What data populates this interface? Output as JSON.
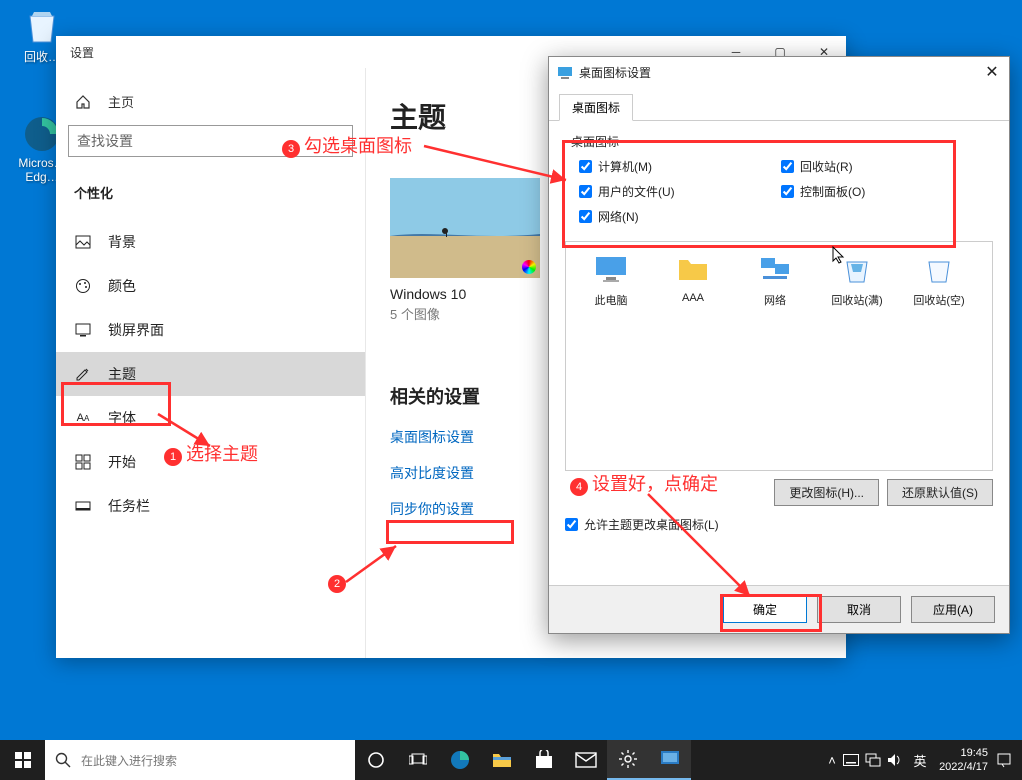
{
  "desktop": {
    "recycle_label": "回收…",
    "edge_label": "Micros… Edg…"
  },
  "settings": {
    "window_title": "设置",
    "home": "主页",
    "search_placeholder": "查找设置",
    "section": "个性化",
    "items": [
      {
        "label": "背景"
      },
      {
        "label": "颜色"
      },
      {
        "label": "锁屏界面"
      },
      {
        "label": "主题"
      },
      {
        "label": "字体"
      },
      {
        "label": "开始"
      },
      {
        "label": "任务栏"
      }
    ],
    "content": {
      "title": "主题",
      "theme_name": "Windows 10",
      "theme_sub": "5 个图像",
      "related_title": "相关的设置",
      "links": [
        "桌面图标设置",
        "高对比度设置",
        "同步你的设置"
      ]
    }
  },
  "dialog": {
    "title": "桌面图标设置",
    "tab": "桌面图标",
    "group_label": "桌面图标",
    "checkboxes": {
      "computer": "计算机(M)",
      "recycle": "回收站(R)",
      "userfiles": "用户的文件(U)",
      "control": "控制面板(O)",
      "network": "网络(N)"
    },
    "icons": [
      "此电脑",
      "AAA",
      "网络",
      "回收站(满)",
      "回收站(空)"
    ],
    "change_icon_btn": "更改图标(H)...",
    "restore_btn": "还原默认值(S)",
    "allow_themes": "允许主题更改桌面图标(L)",
    "ok": "确定",
    "cancel": "取消",
    "apply": "应用(A)"
  },
  "annotations": {
    "one": "选择主题",
    "three": "勾选桌面图标",
    "four": "设置好，点确定"
  },
  "taskbar": {
    "search_placeholder": "在此键入进行搜索",
    "ime": "英",
    "time": "19:45",
    "date": "2022/4/17"
  }
}
